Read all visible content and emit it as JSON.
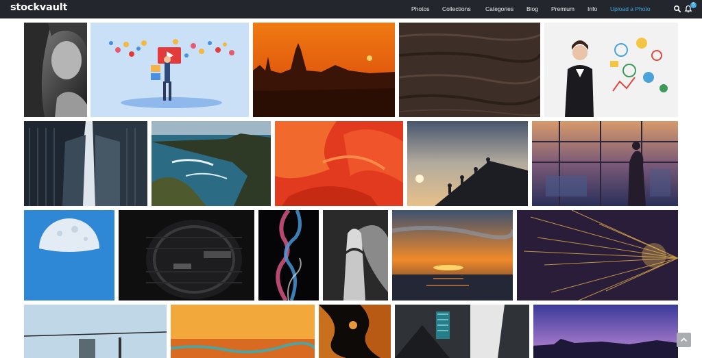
{
  "brand": {
    "logo_text": "stockvault"
  },
  "nav": {
    "photos": "Photos",
    "collections": "Collections",
    "categories": "Categories",
    "blog": "Blog",
    "premium": "Premium",
    "info": "Info",
    "upload": "Upload a Photo"
  },
  "notifications": {
    "count": "5"
  },
  "icons": {
    "search": "search-icon",
    "bell": "bell-icon",
    "back_to_top": "chevron-up-icon"
  },
  "colors": {
    "navbar_bg": "#23272d",
    "accent": "#3fa8df",
    "page_bg": "#ffffff"
  }
}
